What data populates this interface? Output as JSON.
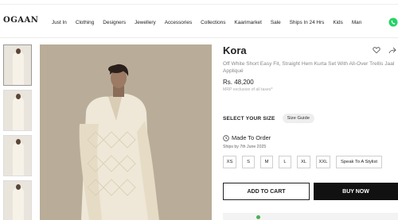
{
  "header": {
    "logo": "OGAAN",
    "nav": [
      "Just In",
      "Clothing",
      "Designers",
      "Jewellery",
      "Accessories",
      "Collections",
      "Kaarimarket",
      "Sale",
      "Ships In 24 Hrs",
      "Kids",
      "Man"
    ]
  },
  "product": {
    "brand": "Kora",
    "name": "Off White Short Easy Fit, Straight Hem Kurta Set With All-Over Trellis Jaal Appliqué",
    "price": "Rs. 48,200",
    "mrp_note": "MRP exclusive of all taxes*"
  },
  "size": {
    "label": "SELECT YOUR SIZE",
    "guide": "Size Guide",
    "options": [
      "XS",
      "S",
      "M",
      "L",
      "XL",
      "XXL",
      "Speak To A Stylist"
    ]
  },
  "made_to_order": {
    "title": "Made To Order",
    "ship_note": "Ships by 7th June 2025"
  },
  "actions": {
    "add_to_cart": "ADD TO CART",
    "buy_now": "BUY NOW"
  },
  "colors": {
    "accent": "#111111",
    "whatsapp": "#25D366",
    "photo_bg": "#b9ad99"
  }
}
